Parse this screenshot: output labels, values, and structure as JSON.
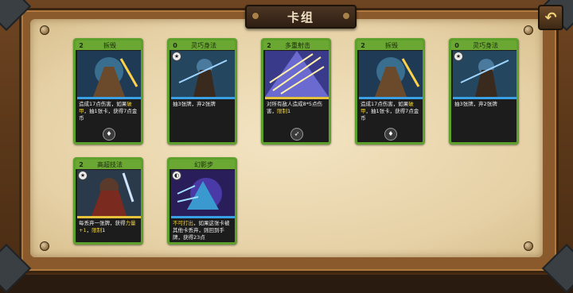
{
  "header": {
    "title": "卡组",
    "back_icon": "return-arrow-icon"
  },
  "cards": [
    {
      "cost": "2",
      "name": "拆毁",
      "text_parts": [
        "造成17点伤害，如果",
        "破甲",
        "，抽1张卡，获得7点金币"
      ],
      "bar_color": "#3aa0e6",
      "badge": "♦"
    },
    {
      "cost": "0",
      "name": "灵巧身法",
      "text_parts": [
        "抽3张牌，弃2张牌"
      ],
      "bar_color": "#3aa0e6",
      "type_icon": "★"
    },
    {
      "cost": "2",
      "name": "多重射击",
      "text_parts": [
        "对所有敌人造成8*5点伤害，",
        "限制",
        "1"
      ],
      "bar_color": "#e6c23a",
      "badge": "➶"
    },
    {
      "cost": "2",
      "name": "拆毁",
      "text_parts": [
        "造成17点伤害，如果",
        "破甲",
        "，抽1张卡，获得7点金币"
      ],
      "bar_color": "#3aa0e6",
      "badge": "♦"
    },
    {
      "cost": "0",
      "name": "灵巧身法",
      "text_parts": [
        "抽3张牌，弃2张牌"
      ],
      "bar_color": "#3aa0e6",
      "type_icon": "★"
    },
    {
      "cost": "2",
      "name": "高超技法",
      "text_parts": [
        "每丢弃一张牌，获得",
        "力量+1",
        "，",
        "限制",
        "1"
      ],
      "bar_color": "#e6c23a",
      "type_icon": "★"
    },
    {
      "cost": "",
      "name": "幻影步",
      "text_parts": [
        "不可打出",
        "，如果这张卡被其他卡丢弃，则回到手牌，获得23点"
      ],
      "bar_color": "#3aa0e6",
      "type_icon": "◐"
    }
  ]
}
